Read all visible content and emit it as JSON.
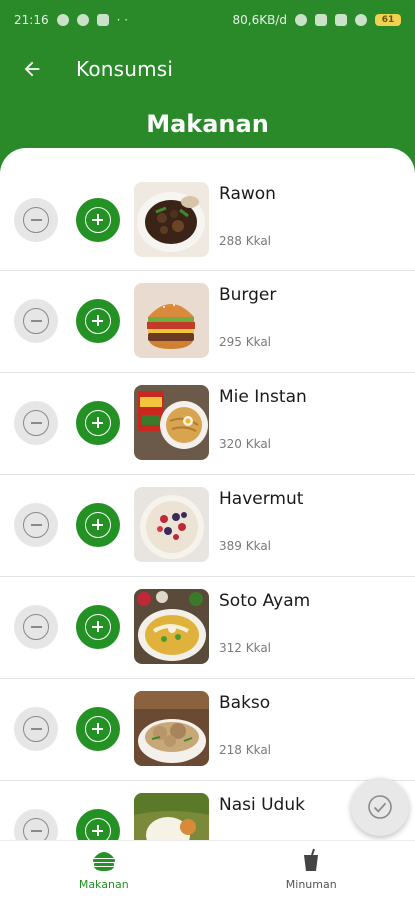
{
  "status_bar": {
    "time": "21:16",
    "left_extra": "· ·",
    "network_speed": "80,6KB/d",
    "battery": "61"
  },
  "appbar": {
    "title": "Konsumsi",
    "back_icon": "arrow-left-icon"
  },
  "section_title": "Makanan",
  "foods": [
    {
      "name": "Rawon",
      "calories": "288 Kkal"
    },
    {
      "name": "Burger",
      "calories": "295 Kkal"
    },
    {
      "name": "Mie Instan",
      "calories": "320 Kkal"
    },
    {
      "name": "Havermut",
      "calories": "389 Kkal"
    },
    {
      "name": "Soto Ayam",
      "calories": "312 Kkal"
    },
    {
      "name": "Bakso",
      "calories": "218 Kkal"
    },
    {
      "name": "Nasi Uduk",
      "calories": ""
    }
  ],
  "bottom_nav": [
    {
      "label": "Makanan",
      "icon": "burger-icon",
      "active": true
    },
    {
      "label": "Minuman",
      "icon": "drink-icon",
      "active": false
    }
  ],
  "colors": {
    "primary": "#2a8a2a",
    "button_green": "#249124",
    "minus_bg": "#e6e6e6"
  }
}
